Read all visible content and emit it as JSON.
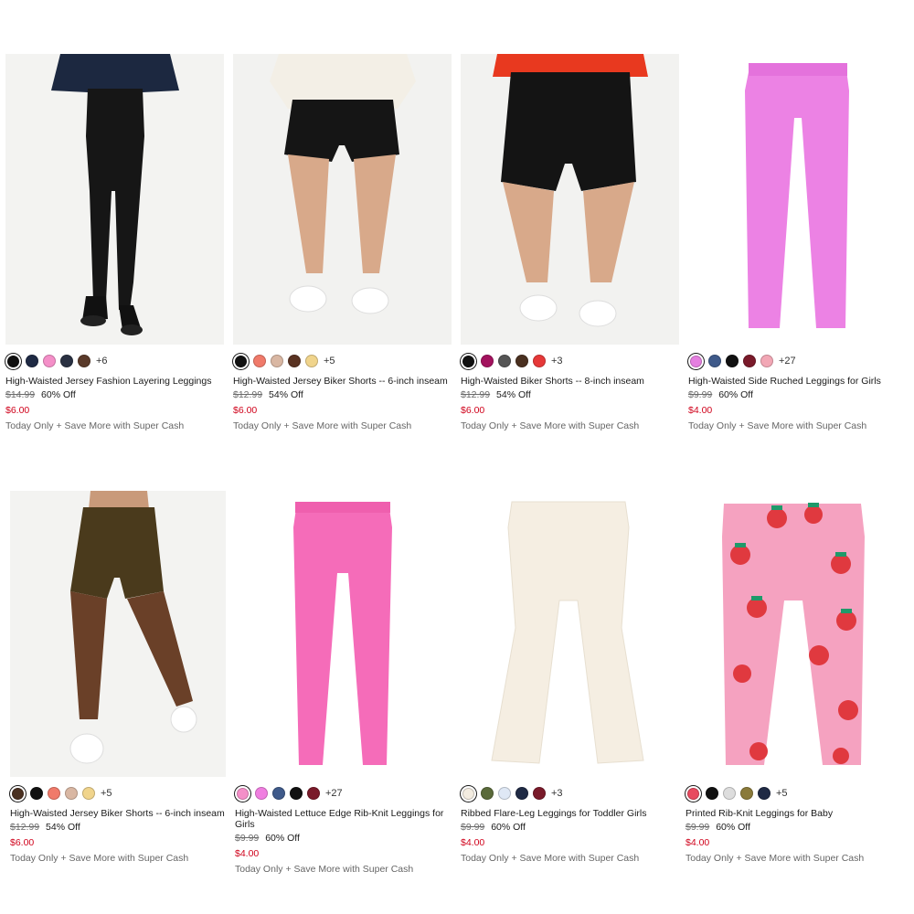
{
  "products": [
    {
      "name": "High-Waisted Jersey Fashion Layering Leggings",
      "regular_price": "$14.99",
      "discount": "60% Off",
      "sale_price": "$6.00",
      "promo": "Today Only + Save More with Super Cash",
      "swatches": [
        "#111111",
        "#1f2a44",
        "#f48fc8",
        "#2a3142",
        "#5a3a2a"
      ],
      "more_colors": "+6"
    },
    {
      "name": "High-Waisted Jersey Biker Shorts -- 6-inch inseam",
      "regular_price": "$12.99",
      "discount": "54% Off",
      "sale_price": "$6.00",
      "promo": "Today Only + Save More with Super Cash",
      "swatches": [
        "#111111",
        "#f07a6a",
        "#d9b7a3",
        "#5a3322",
        "#f0d48c"
      ],
      "more_colors": "+5"
    },
    {
      "name": "High-Waisted Biker Shorts -- 8-inch inseam",
      "regular_price": "$12.99",
      "discount": "54% Off",
      "sale_price": "$6.00",
      "promo": "Today Only + Save More with Super Cash",
      "swatches": [
        "#111111",
        "#a3125e",
        "#555555",
        "#4a3020",
        "#e63838"
      ],
      "more_colors": "+3"
    },
    {
      "name": "High-Waisted Side Ruched Leggings for Girls",
      "regular_price": "$9.99",
      "discount": "60% Off",
      "sale_price": "$4.00",
      "promo": "Today Only + Save More with Super Cash",
      "swatches": [
        "#e57fe0",
        "#3f5a8a",
        "#111111",
        "#7a1a2a",
        "#f2a7b5"
      ],
      "more_colors": "+27"
    },
    {
      "name": "High-Waisted Jersey Biker Shorts -- 6-inch inseam",
      "regular_price": "$12.99",
      "discount": "54% Off",
      "sale_price": "$6.00",
      "promo": "Today Only + Save More with Super Cash",
      "swatches": [
        "#4a3020",
        "#111111",
        "#f07a6a",
        "#d9b7a3",
        "#f0d48c"
      ],
      "more_colors": "+5"
    },
    {
      "name": "High-Waisted Lettuce Edge Rib-Knit Leggings for Girls",
      "regular_price": "$9.99",
      "discount": "60% Off",
      "sale_price": "$4.00",
      "promo": "Today Only + Save More with Super Cash",
      "swatches": [
        "#f48fc8",
        "#f07ee0",
        "#3f5a8a",
        "#111111",
        "#7a1a2a"
      ],
      "more_colors": "+27"
    },
    {
      "name": "Ribbed Flare-Leg Leggings for Toddler Girls",
      "regular_price": "$9.99",
      "discount": "60% Off",
      "sale_price": "$4.00",
      "promo": "Today Only + Save More with Super Cash",
      "swatches": [
        "#f3ece0",
        "#5a6a3a",
        "#dfe8f5",
        "#1f2a44",
        "#7a1a2a"
      ],
      "more_colors": "+3"
    },
    {
      "name": "Printed Rib-Knit Leggings for Baby",
      "regular_price": "$9.99",
      "discount": "60% Off",
      "sale_price": "$4.00",
      "promo": "Today Only + Save More with Super Cash",
      "swatches": [
        "#e84a5f",
        "#111111",
        "#dddddd",
        "#8a7a3a",
        "#1f2a44"
      ],
      "more_colors": "+5"
    }
  ]
}
